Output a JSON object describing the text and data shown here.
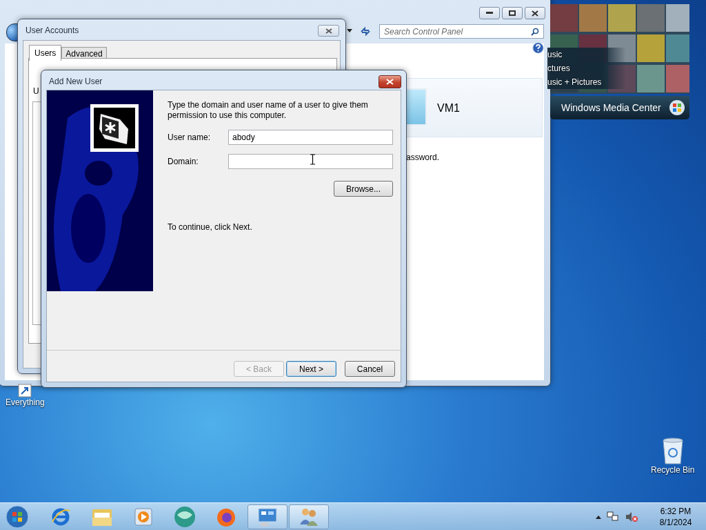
{
  "control_panel_window": {
    "search": {
      "placeholder": "Search Control Panel"
    },
    "account_name": "VM1",
    "partial_text": "assword."
  },
  "media_center_gadget": {
    "items": [
      "usic",
      "ctures",
      "usic + Pictures"
    ],
    "title": "Windows Media Center"
  },
  "user_accounts_window": {
    "title": "User Accounts",
    "tabs": [
      {
        "label": "Users",
        "selected": true
      },
      {
        "label": "Advanced",
        "selected": false
      }
    ],
    "partial_label": "U"
  },
  "dialog": {
    "title": "Add New User",
    "instructions": "Type the domain and user name of a user to give them permission to use this computer.",
    "fields": [
      {
        "label": "User name:",
        "value": "abody"
      },
      {
        "label": "Domain:"
      }
    ],
    "browse_button": "Browse...",
    "hint": "To continue, click Next.",
    "buttons": [
      {
        "label": "< Back",
        "disabled": true,
        "default": false
      },
      {
        "label": "Next >",
        "disabled": false,
        "default": true
      },
      {
        "label": "Cancel",
        "disabled": false,
        "default": false
      }
    ]
  },
  "desktop_icons": [
    {
      "kind": "shortcut",
      "label": "Everything"
    },
    {
      "kind": "recycle-bin",
      "label": "Recycle Bin"
    }
  ],
  "taskbar": {
    "items": [
      {
        "kind": "browser-e",
        "active": false
      },
      {
        "kind": "folder",
        "active": false
      },
      {
        "kind": "media-player",
        "active": false
      },
      {
        "kind": "green-sphere",
        "active": false
      },
      {
        "kind": "fox-browser",
        "active": false
      },
      {
        "kind": "control-panel",
        "active": true
      },
      {
        "kind": "users",
        "active": true
      }
    ],
    "clock": {
      "time": "6:32 PM",
      "date": "8/1/2024"
    }
  }
}
